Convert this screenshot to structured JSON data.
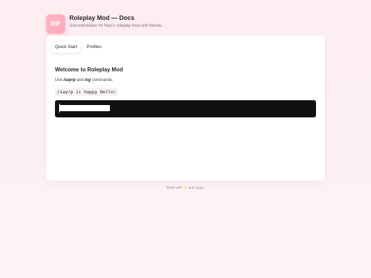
{
  "header": {
    "logo_text": "RP",
    "title": "Roleplay Mod — Docs",
    "subtitle": "Documentation for Navi's roleplay mod and friends."
  },
  "tabs": [
    {
      "label": "Quick Start",
      "active": true
    },
    {
      "label": "Profiles",
      "active": false
    }
  ],
  "content": {
    "heading": "Welcome to Roleplay Mod",
    "desc_prefix": "Use ",
    "cmd1": "/sayrp",
    "desc_mid": " and ",
    "cmd2": "/cg",
    "desc_suffix": " commands.",
    "example_code": "/sayrp ic happy Hello!"
  },
  "footer": {
    "text": "Made with ✨ and sugar."
  },
  "colors": {
    "background": "#fdf0f3",
    "logo_gradient": "#ffb7c5",
    "terminal": "#111111"
  }
}
